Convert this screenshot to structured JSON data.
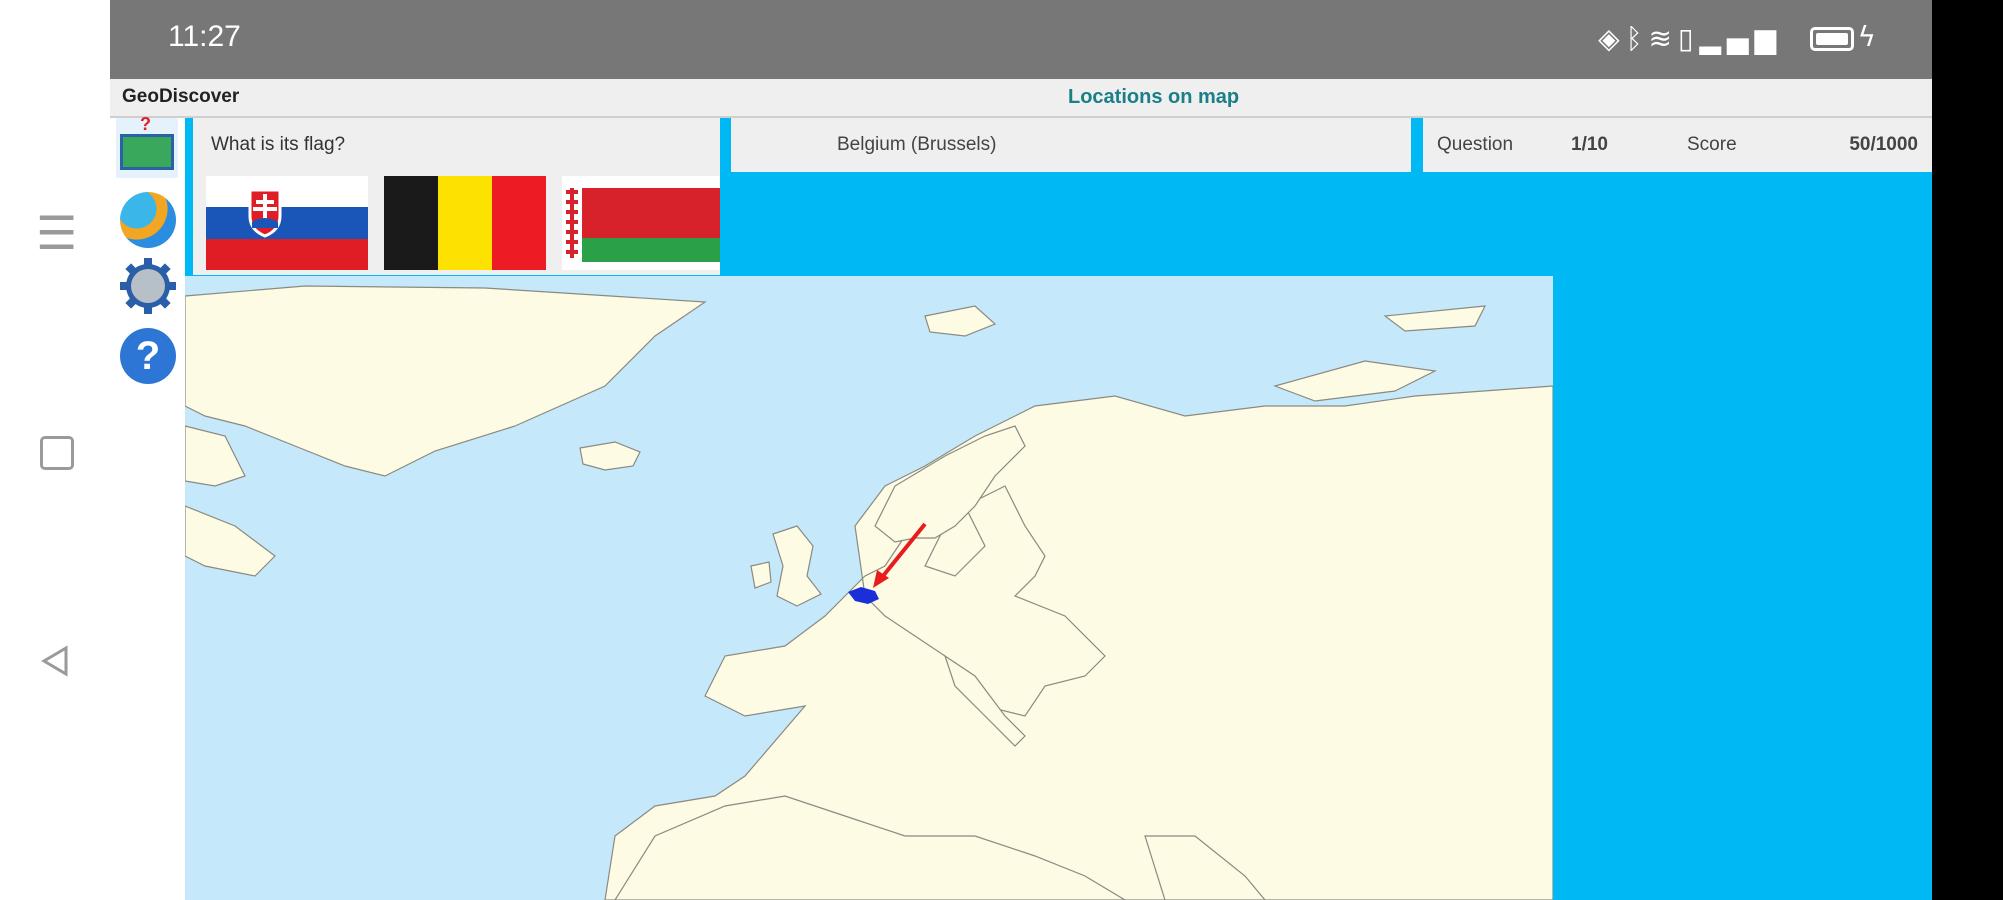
{
  "status_bar": {
    "time": "11:27",
    "icons": [
      "nfc-icon",
      "bluetooth-icon",
      "wifi-icon",
      "vibrate-icon",
      "signal-icon",
      "battery-icon",
      "charging-icon"
    ]
  },
  "nav_bar": {
    "buttons": [
      "menu-icon",
      "home-icon",
      "back-icon"
    ]
  },
  "app": {
    "name": "GeoDiscover",
    "page_title": "Locations on map"
  },
  "toolbar": {
    "items": [
      "map-quiz-icon",
      "globe-icon",
      "settings-gear-icon",
      "help-icon"
    ]
  },
  "quiz": {
    "question": "What is its flag?",
    "flag_options": [
      "Slovakia",
      "Belgium",
      "Belarus"
    ],
    "answer": "Belgium (Brussels)",
    "question_label": "Question",
    "question_value": "1/10",
    "score_label": "Score",
    "score_value": "50/1000"
  },
  "colors": {
    "accent": "#00b8f3",
    "status_bar": "#777777",
    "title_teal": "#1a7f86",
    "map_sea": "#c6e8fb",
    "map_land": "#fdfbe4",
    "highlight": "#1a2fd8",
    "arrow": "#e81c1c"
  }
}
